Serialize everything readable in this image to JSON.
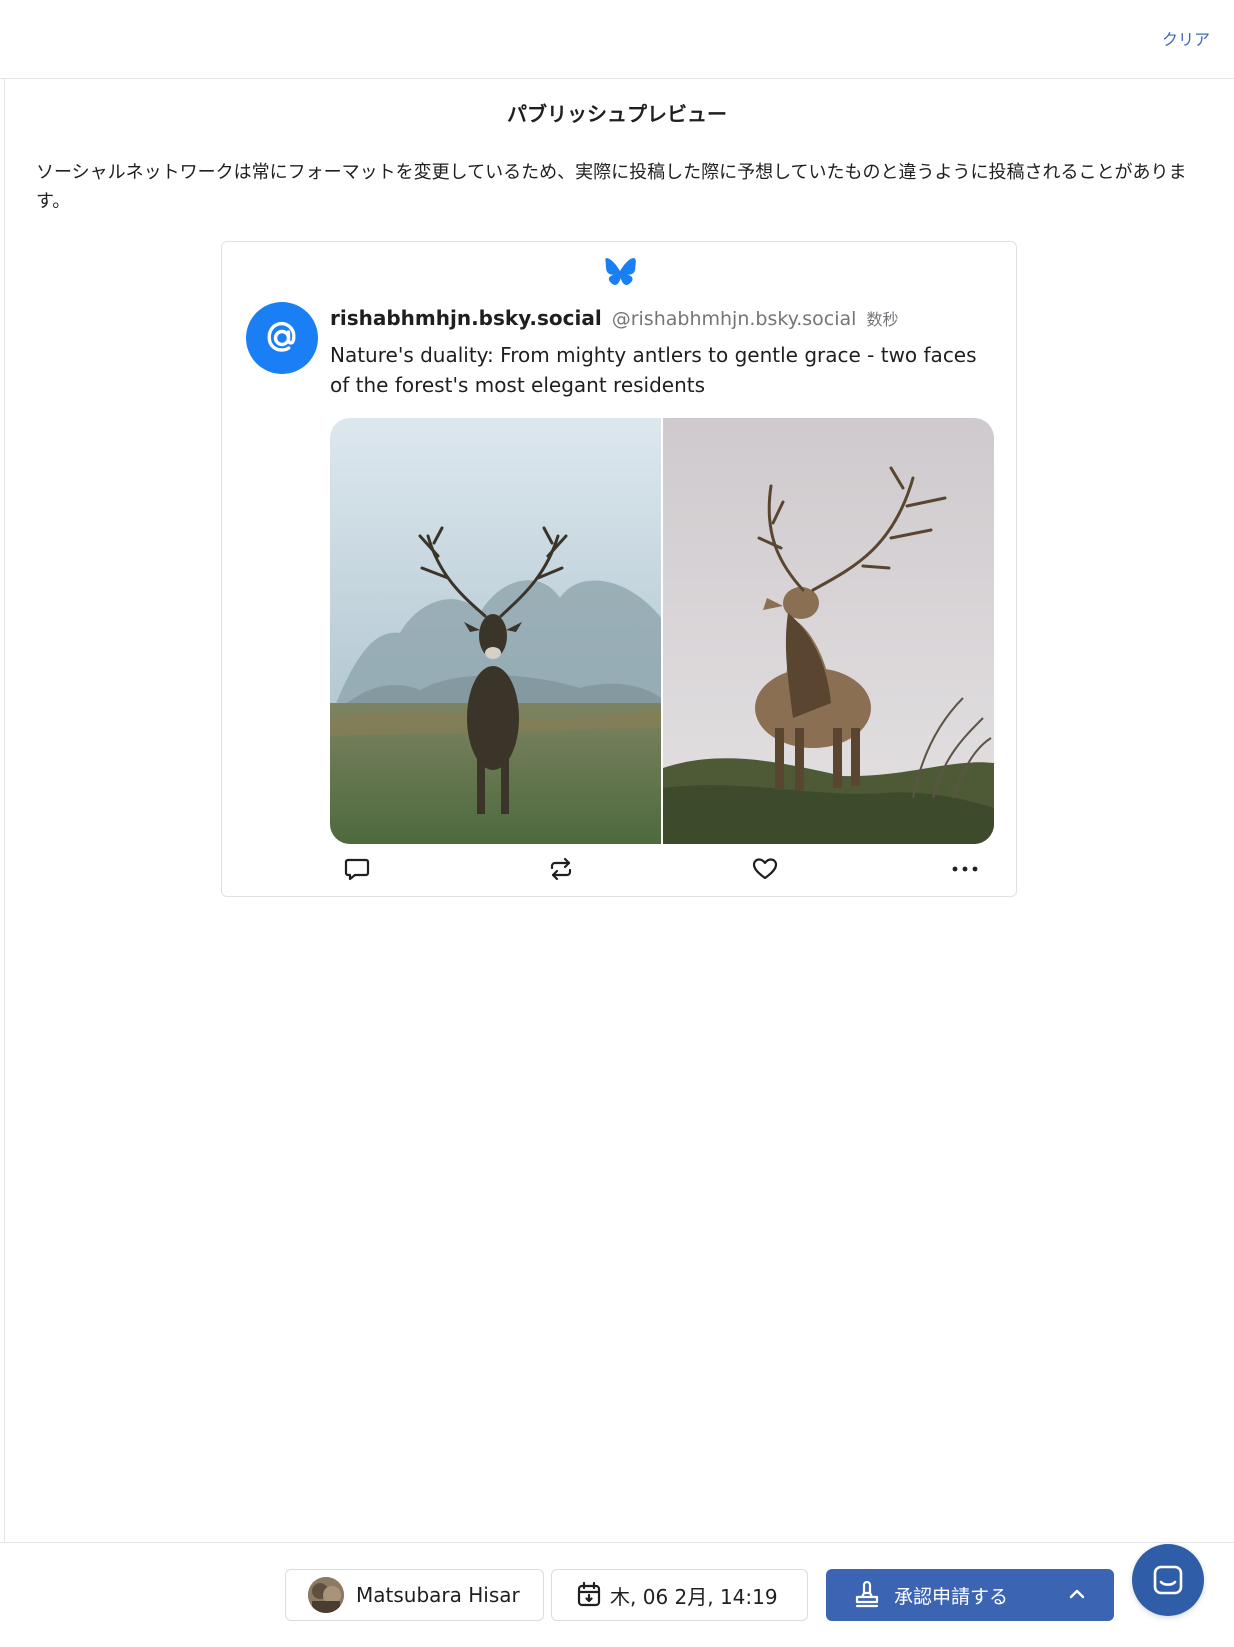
{
  "header": {
    "clear_label": "クリア"
  },
  "preview": {
    "title": "パブリッシュプレビュー",
    "notice": "ソーシャルネットワークは常にフォーマットを変更しているため、実際に投稿した際に予想していたものと違うように投稿されることがあります。"
  },
  "post": {
    "display_name": "rishabhmhjn.bsky.social",
    "handle": "@rishabhmhjn.bsky.social",
    "time": "数秒",
    "text": "Nature's duality: From mighty antlers to gentle grace - two faces of the forest's most elegant residents",
    "icons": [
      "butterfly-icon",
      "at-sign-icon",
      "comment-icon",
      "repost-icon",
      "heart-icon",
      "more-icon"
    ]
  },
  "footer": {
    "author_name": "Matsubara Hisar",
    "schedule": "木, 06 2月, 14:19",
    "submit_label": "承認申請する"
  },
  "colors": {
    "accent": "#3b64b3",
    "bluesky": "#1a7ef5",
    "link": "#3f6ab7"
  }
}
